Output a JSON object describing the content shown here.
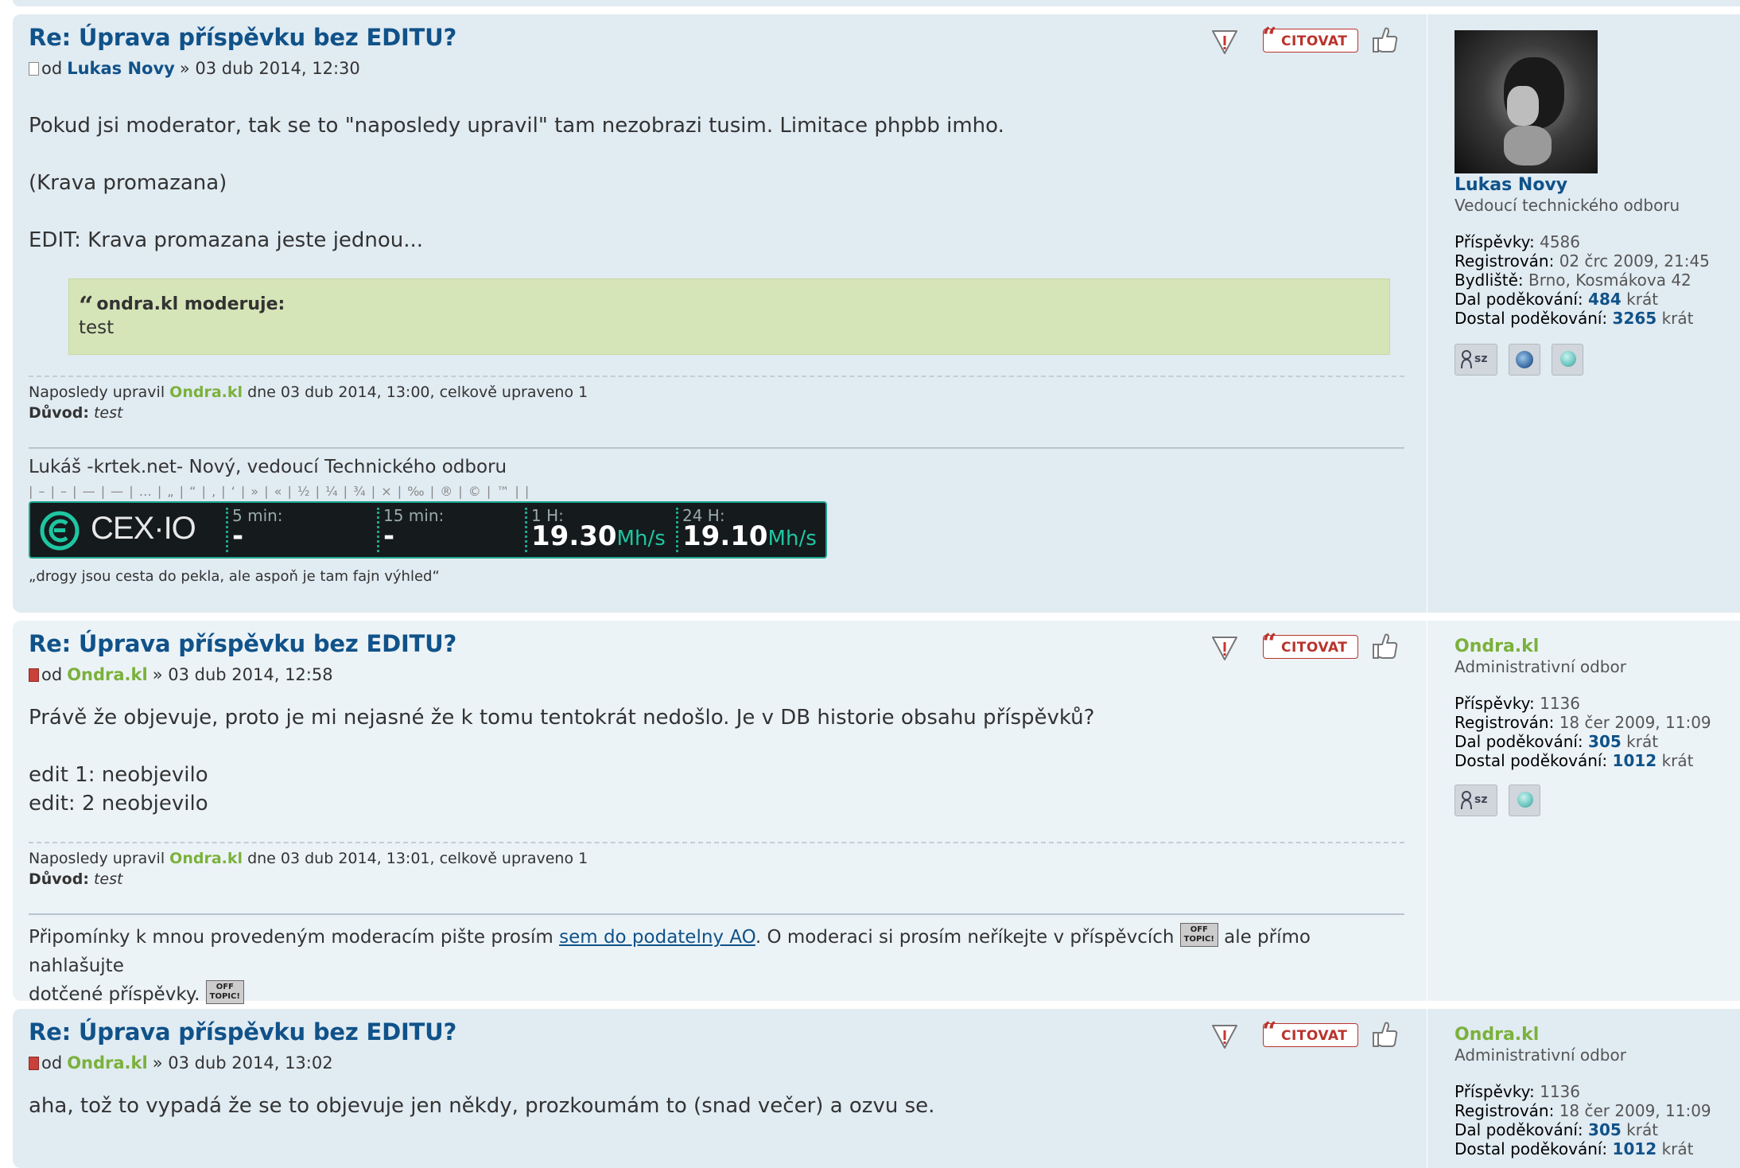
{
  "buttons": {
    "quote_label": "CITOVAT"
  },
  "posts": [
    {
      "title": "Re: Úprava příspěvku bez EDITU?",
      "by": "od",
      "author": "Lukas Novy",
      "date": "» 03 dub 2014, 12:30",
      "lines": [
        "Pokud jsi moderator, tak se to \"naposledy upravil\" tam nezobrazi tusim. Limitace phpbb imho.",
        "(Krava promazana)",
        "EDIT: Krava promazana jeste jednou..."
      ],
      "quote": {
        "cite": "ondra.kl moderuje:",
        "text": "test"
      },
      "edit": {
        "prefix": "Naposledy upravil",
        "editor": "Ondra.kl",
        "suffix": "dne 03 dub 2014, 13:00, celkově upraveno 1",
        "reason_label": "Důvod:",
        "reason": "test"
      },
      "signature": {
        "line1": "Lukáš -krtek.net- Nový, vedoucí Technického odboru",
        "chars": "| – | – | — | — | … | „ | “ | ‚ | ‘ | » | « | ½ | ¼ | ¾ | × | ‰ | ® | © | ™ | |",
        "cex": {
          "brand": "CEX·IO",
          "l5": "5 min:",
          "v5": "-",
          "l15": "15 min:",
          "v15": "-",
          "l1h": "1 H:",
          "v1h": "19.30",
          "u1h": "Mh/s",
          "l24h": "24 H:",
          "v24h": "19.10",
          "u24h": "Mh/s"
        },
        "quote": "„drogy jsou cesta do pekla, ale aspoň je tam fajn výhled“"
      },
      "profile": {
        "username": "Lukas Novy",
        "rank": "Vedoucí technického odboru",
        "stats": [
          {
            "k": "Příspěvky:",
            "v": "4586"
          },
          {
            "k": "Registrován:",
            "v": "02 črc 2009, 21:45"
          },
          {
            "k": "Bydliště:",
            "v": "Brno, Kosmákova 42"
          },
          {
            "k": "Dal poděkování:",
            "n": "484",
            "v": "krát"
          },
          {
            "k": "Dostal poděkování:",
            "n": "3265",
            "v": "krát"
          }
        ],
        "pm_label": "sz"
      }
    },
    {
      "title": "Re: Úprava příspěvku bez EDITU?",
      "by": "od",
      "author": "Ondra.kl",
      "date": "» 03 dub 2014, 12:58",
      "lines": [
        "Právě že objevuje, proto je mi nejasné že k tomu tentokrát nedošlo. Je v DB historie obsahu příspěvků?",
        "edit 1: neobjevilo",
        "edit: 2 neobjevilo"
      ],
      "edit": {
        "prefix": "Naposledy upravil",
        "editor": "Ondra.kl",
        "suffix": "dne 03 dub 2014, 13:01, celkově upraveno 1",
        "reason_label": "Důvod:",
        "reason": "test"
      },
      "signature": {
        "t1": "Připomínky k mnou provedeným moderacím pište prosím",
        "link": "sem do podatelny AO",
        "t2": ". O moderaci si prosím neříkejte v příspěvcích",
        "t3": "ale přímo nahlašujte",
        "t4": "dotčené příspěvky.",
        "offtopic": "OFF TOPIC!"
      },
      "profile": {
        "username": "Ondra.kl",
        "rank": "Administrativní odbor",
        "stats": [
          {
            "k": "Příspěvky:",
            "v": "1136"
          },
          {
            "k": "Registrován:",
            "v": "18 čer 2009, 11:09"
          },
          {
            "k": "Dal poděkování:",
            "n": "305",
            "v": "krát"
          },
          {
            "k": "Dostal poděkování:",
            "n": "1012",
            "v": "krát"
          }
        ],
        "pm_label": "sz"
      }
    },
    {
      "title": "Re: Úprava příspěvku bez EDITU?",
      "by": "od",
      "author": "Ondra.kl",
      "date": "» 03 dub 2014, 13:02",
      "lines": [
        "aha, tož to vypadá že se to objevuje jen někdy, prozkoumám to (snad večer) a ozvu se."
      ],
      "profile": {
        "username": "Ondra.kl",
        "rank": "Administrativní odbor",
        "stats": [
          {
            "k": "Příspěvky:",
            "v": "1136"
          },
          {
            "k": "Registrován:",
            "v": "18 čer 2009, 11:09"
          },
          {
            "k": "Dal poděkování:",
            "n": "305",
            "v": "krát"
          },
          {
            "k": "Dostal poděkování:",
            "n": "1012",
            "v": "krát"
          }
        ]
      }
    }
  ]
}
